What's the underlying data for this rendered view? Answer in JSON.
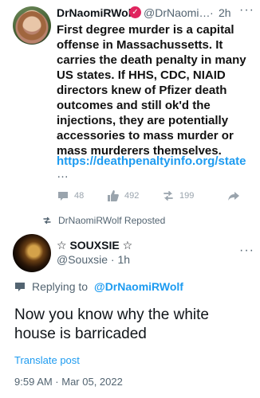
{
  "retweeted_tweet": {
    "author_name": "DrNaomiRWolf",
    "author_handle": "@DrNaomi…",
    "dot": "·",
    "time": "2h",
    "more": "···",
    "verified_glyph": "✓",
    "body": "First degree murder is a capital offense in Massachussetts. It carries the death penalty in many US states. If HHS, CDC, NIAID directors knew of Pfizer death outcomes and still ok'd the injections, they are potentially accessories to mass murder or mass murderers themselves.",
    "link": "https://deathpenaltyinfo.org/state",
    "ellipsis": "…",
    "replies": "48",
    "likes": "492",
    "reposts": "199"
  },
  "repost_line": {
    "label": "DrNaomiRWolf Reposted"
  },
  "reply_tweet": {
    "author_name": "☆ SOUXSIE ☆",
    "author_handle": "@Souxsie · 1h",
    "more": "···",
    "replying_prefix": "Replying to",
    "replying_to": "@DrNaomiRWolf",
    "body": "Now you know why the white house is barricaded",
    "translate": "Translate post",
    "timestamp": "9:59 AM · Mar 05, 2022"
  }
}
